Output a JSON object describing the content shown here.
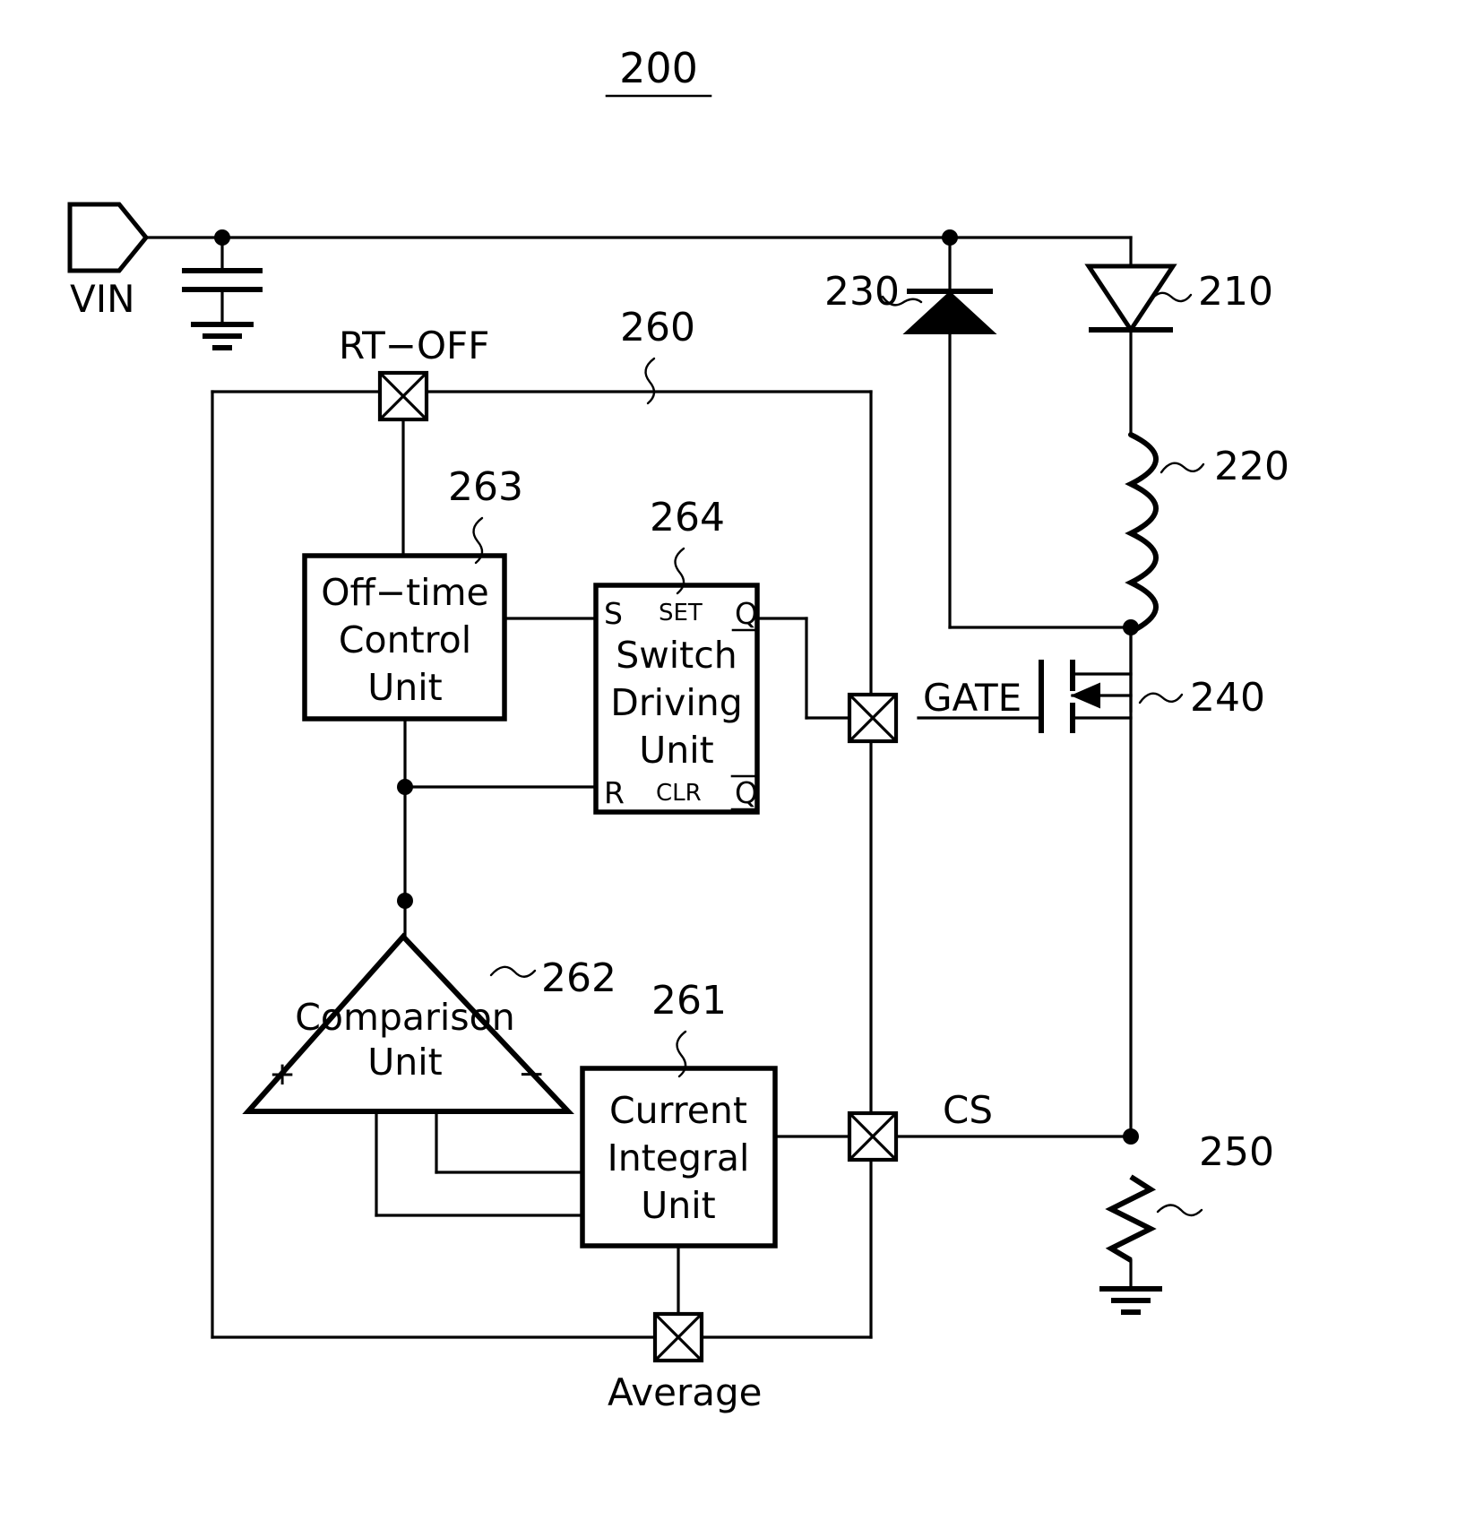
{
  "figure": {
    "number": "200",
    "type": "patent-circuit-schematic",
    "description": "LED driver circuit schematic with off-time control, switch driving, comparison and current integral units"
  },
  "terminals": {
    "vin_label": "VIN",
    "gate_label": "GATE",
    "cs_label": "CS",
    "rt_off_label": "RT−OFF",
    "average_label": "Average"
  },
  "reference_numerals": {
    "led": "210",
    "inductor": "220",
    "diode": "230",
    "transistor": "240",
    "sense_resistor": "250",
    "controller": "260",
    "current_integral_unit": "261",
    "comparison_unit": "262",
    "off_time_control_unit": "263",
    "switch_driving_unit": "264"
  },
  "blocks": {
    "off_time_control": {
      "lines": [
        "Off−time",
        "Control",
        "Unit"
      ]
    },
    "switch_driving": {
      "lines": [
        "Switch",
        "Driving",
        "Unit"
      ],
      "pins": {
        "set_in": "S",
        "set_label": "SET",
        "q_out": "Q",
        "reset_in": "R",
        "clear_label": "CLR",
        "qbar_out": "Q"
      }
    },
    "comparison": {
      "lines": [
        "Comparison",
        "Unit"
      ],
      "plus": "+",
      "minus": "−"
    },
    "current_integral": {
      "lines": [
        "Current",
        "Integral",
        "Unit"
      ]
    }
  },
  "colors": {
    "ink": "#000000",
    "paper": "#ffffff"
  }
}
